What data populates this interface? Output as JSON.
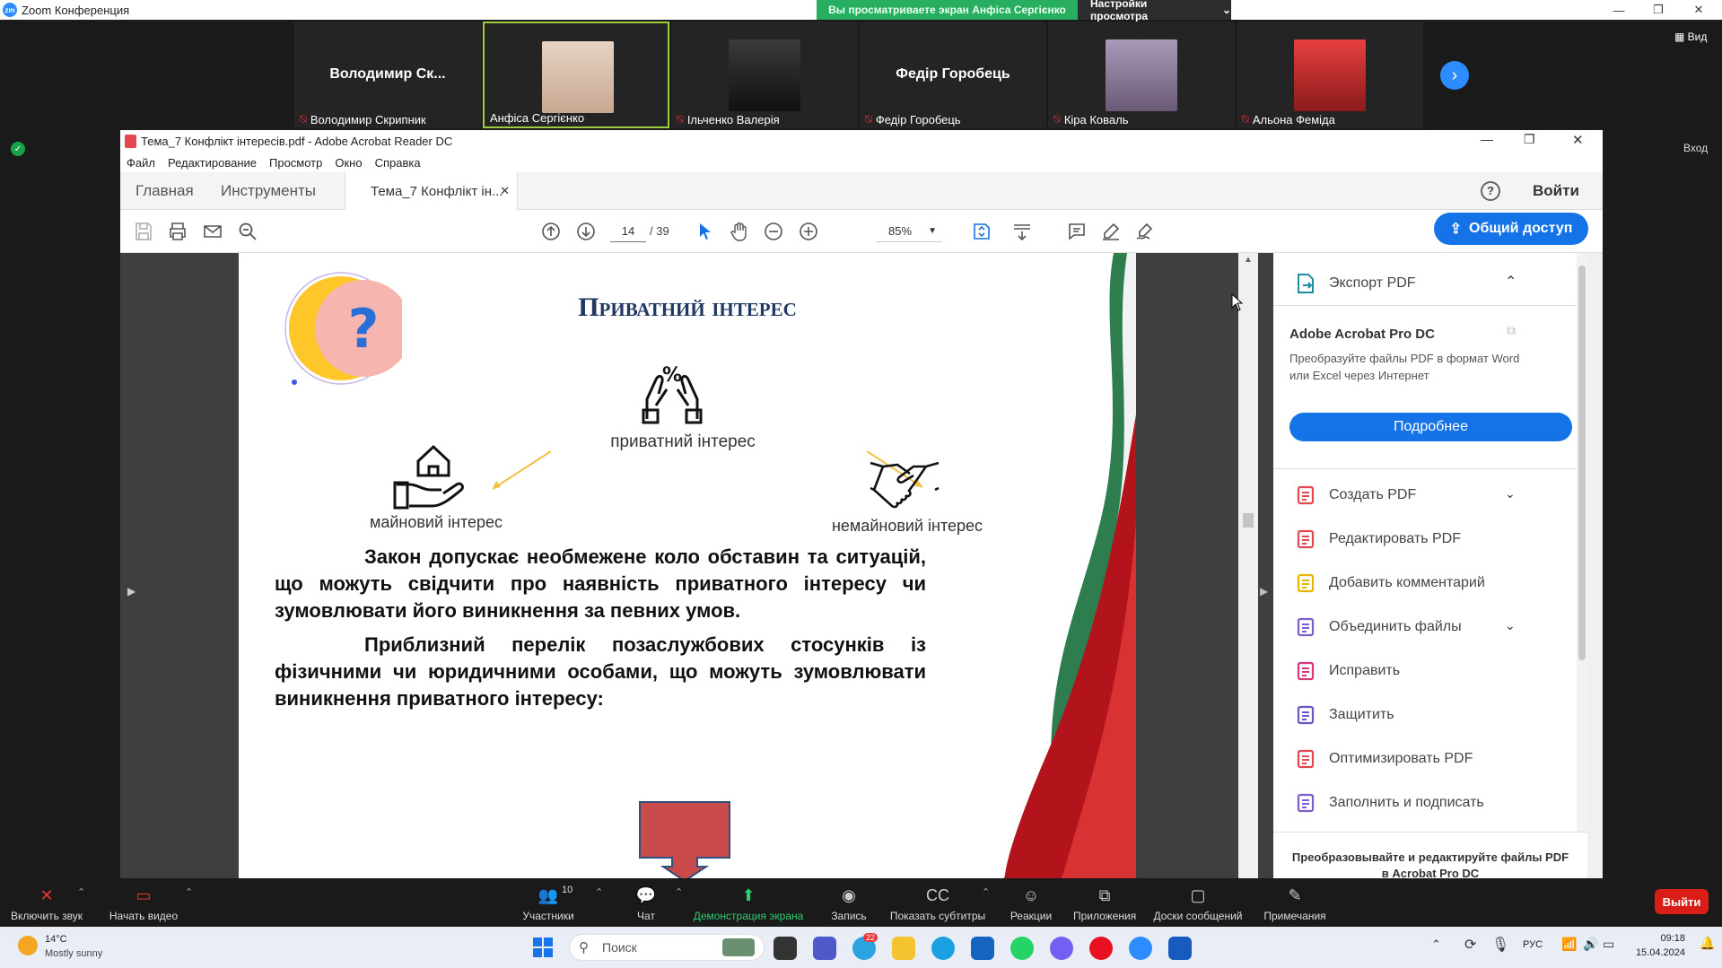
{
  "zoom": {
    "title": "Zoom Конференция",
    "viewing_banner": "Вы просматриваете экран Анфіса Сергієнко",
    "view_settings": "Настройки просмотра",
    "view_button": "Вид",
    "login": "Вход",
    "participants": [
      {
        "display": "Володимир  Ск...",
        "label": "Володимир Скрипник",
        "muted": true,
        "video": false
      },
      {
        "display": "",
        "label": "Анфіса Сергієнко",
        "muted": false,
        "video": true,
        "active": true
      },
      {
        "display": "",
        "label": "Ільченко Валерія",
        "muted": true,
        "video": true
      },
      {
        "display": "Федір Горобець",
        "label": "Федір Горобець",
        "muted": true,
        "video": false
      },
      {
        "display": "",
        "label": "Кіра Коваль",
        "muted": true,
        "video": true
      },
      {
        "display": "",
        "label": "Альона Феміда",
        "muted": true,
        "video": true
      }
    ],
    "toolbar": {
      "unmute": "Включить звук",
      "start_video": "Начать видео",
      "participants": "Участники",
      "participants_count": "10",
      "chat": "Чат",
      "share": "Демонстрация экрана",
      "record": "Запись",
      "captions": "Показать субтитры",
      "reactions": "Реакции",
      "apps": "Приложения",
      "whiteboards": "Доски сообщений",
      "notes": "Примечания",
      "leave": "Выйти"
    }
  },
  "acrobat": {
    "title": "Тема_7 Конфлікт інтересів.pdf - Adobe Acrobat Reader DC",
    "menu": [
      "Файл",
      "Редактирование",
      "Просмотр",
      "Окно",
      "Справка"
    ],
    "tabs": {
      "home": "Главная",
      "tools": "Инструменты",
      "doc": "Тема_7 Конфлікт ін...",
      "login": "Войти"
    },
    "page_current": "14",
    "page_total": "/ 39",
    "zoom": "85%",
    "share_label": "Общий доступ",
    "panel": {
      "export": "Экспорт PDF",
      "pro_title": "Adobe Acrobat Pro DC",
      "pro_desc": "Преобразуйте файлы PDF в формат Word или Excel через Интернет",
      "more_btn": "Подробнее",
      "items": [
        {
          "label": "Создать PDF",
          "icon": "create-pdf-icon",
          "color": "#e34850",
          "chevron": true
        },
        {
          "label": "Редактировать PDF",
          "icon": "edit-pdf-icon",
          "color": "#e34850",
          "chevron": false
        },
        {
          "label": "Добавить комментарий",
          "icon": "comment-icon",
          "color": "#e8b600",
          "chevron": false
        },
        {
          "label": "Объединить файлы",
          "icon": "combine-icon",
          "color": "#7c5ccf",
          "chevron": true
        },
        {
          "label": "Исправить",
          "icon": "fix-icon",
          "color": "#d8367a",
          "chevron": false
        },
        {
          "label": "Защитить",
          "icon": "protect-icon",
          "color": "#6b56c9",
          "chevron": false
        },
        {
          "label": "Оптимизировать PDF",
          "icon": "optimize-icon",
          "color": "#e34850",
          "chevron": false
        },
        {
          "label": "Заполнить и подписать",
          "icon": "sign-icon",
          "color": "#7c5ccf",
          "chevron": false
        }
      ],
      "footer": "Преобразовывайте и редактируйте файлы PDF в Acrobat Pro DC"
    }
  },
  "slide": {
    "title": "Приватний інтерес",
    "private": "приватний інтерес",
    "property": "майновий інтерес",
    "nonproperty": "немайновий інтерес",
    "para1": "Закон допускає необмежене коло обставин та ситуацій, що можуть свідчити про наявність приватного інтересу чи зумовлювати його виникнення за певних умов.",
    "para2": "Приблизний перелік позаслужбових стосунків із фізичними чи юридичними особами, що можуть зумовлювати виникнення приватного інтересу:"
  },
  "taskbar": {
    "temp": "14°C",
    "weather": "Mostly sunny",
    "search": "Поиск",
    "lang": "РУС",
    "time": "09:18",
    "date": "15.04.2024",
    "telegram_badge": "22"
  },
  "colors": {
    "zoom_blue": "#2d8cff",
    "acrobat_blue": "#1473e6",
    "banner_green": "#27ae60",
    "slide_title": "#1f3864",
    "leave_red": "#d91e18"
  }
}
